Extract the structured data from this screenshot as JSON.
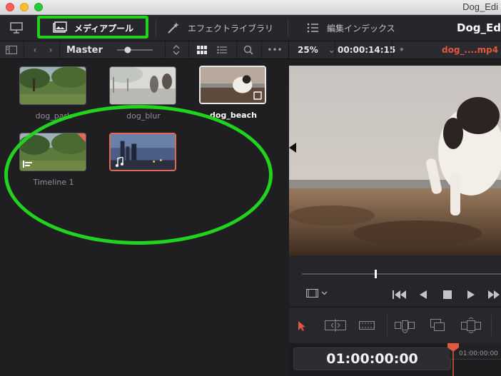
{
  "window": {
    "title": "Dog_Edi"
  },
  "topbar": {
    "media_pool_label": "メディアプール",
    "effects_library_label": "エフェクトライブラリ",
    "edit_index_label": "編集インデックス",
    "project_title": "Dog_Ed"
  },
  "media_pool": {
    "bin_name": "Master",
    "clips": [
      {
        "name": "dog_park"
      },
      {
        "name": "dog_blur"
      },
      {
        "name": "dog_beach"
      },
      {
        "name": "Timeline 1"
      },
      {
        "name": ""
      }
    ]
  },
  "viewer": {
    "zoom": "25%",
    "timecode": "00:00:14:15",
    "clip_name": "dog_....mp4",
    "clip_name_color": "#e0583f"
  },
  "timeline": {
    "timecode": "01:00:00:00",
    "ruler_label": "01:00:00:00"
  },
  "colors": {
    "highlight": "#21d21f",
    "accent": "#e0583f"
  }
}
